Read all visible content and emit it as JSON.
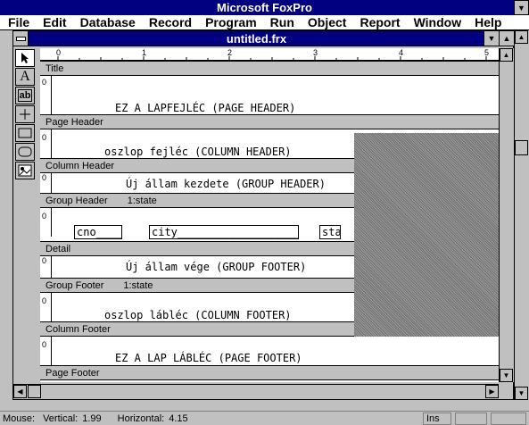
{
  "app": {
    "title": "Microsoft FoxPro"
  },
  "menu": [
    "File",
    "Edit",
    "Database",
    "Record",
    "Program",
    "Run",
    "Object",
    "Report",
    "Window",
    "Help"
  ],
  "document": {
    "title": "untitled.frx"
  },
  "toolbox": {
    "text_tool": "A",
    "field_tool": "ab"
  },
  "ruler": {
    "labels": [
      "0",
      "1",
      "2",
      "3",
      "4",
      "5"
    ]
  },
  "bands": {
    "zero": "0",
    "title": {
      "label": "Title"
    },
    "page_header": {
      "text": "EZ A LAPFEJLÉC (PAGE HEADER)",
      "label": "Page Header"
    },
    "column_header": {
      "text": "oszlop fejléc  (COLUMN HEADER)",
      "label": "Column Header"
    },
    "group_header": {
      "text": "Új állam kezdete (GROUP HEADER)",
      "label": "Group Header",
      "expr": "1:state"
    },
    "detail": {
      "label": "Detail",
      "fields": [
        "cno____",
        "city____________________",
        "sta"
      ]
    },
    "group_footer": {
      "text": "Új állam vége (GROUP FOOTER)",
      "label": "Group Footer",
      "expr": "1:state"
    },
    "column_footer": {
      "text": "oszlop lábléc  (COLUMN FOOTER)",
      "label": "Column Footer"
    },
    "page_footer": {
      "text": "EZ A LAP LÁBLÉC (PAGE FOOTER)",
      "label": "Page Footer"
    }
  },
  "status": {
    "mouse": "Mouse:",
    "vertical_label": "Vertical:",
    "vertical_value": "1.99",
    "horizontal_label": "Horizontal:",
    "horizontal_value": "4.15",
    "ins": "Ins"
  }
}
